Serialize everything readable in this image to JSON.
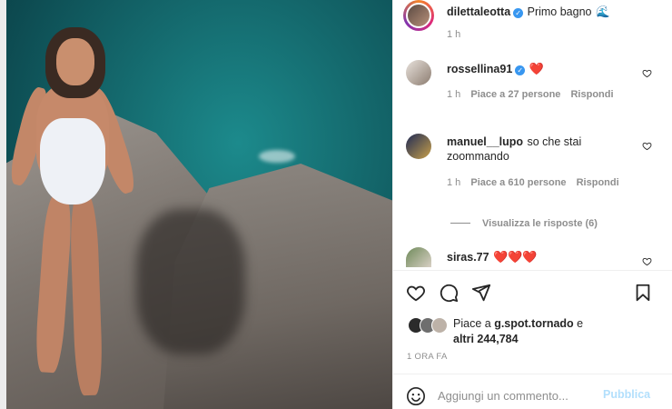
{
  "post": {
    "author": "dilettaleotta",
    "caption": "Primo bagno",
    "caption_emoji": "🌊",
    "time": "1 h"
  },
  "comments": [
    {
      "user": "rossellina91",
      "verified": true,
      "text": "❤️",
      "time": "1 h",
      "likes": "Piace a 27 persone",
      "reply": "Rispondi"
    },
    {
      "user": "manuel__lupo",
      "verified": false,
      "text_line1": "so che stai",
      "text_line2": "zoommando",
      "time": "1 h",
      "likes": "Piace a 610 persone",
      "reply": "Rispondi",
      "view_replies": "Visualizza le risposte (6)"
    },
    {
      "user": "siras.77",
      "verified": false,
      "text": "❤️❤️❤️"
    }
  ],
  "likes": {
    "prefix": "Piace a",
    "user": "g.spot.tornado",
    "suffix": "e",
    "others": "altri 244,784"
  },
  "timestamp": "1 ORA FA",
  "composer": {
    "placeholder": "Aggiungi un commento...",
    "publish_label": "Pubblica"
  },
  "icons": {
    "like": "heart-outline-icon",
    "comment": "comment-bubble-icon",
    "share": "paper-plane-icon",
    "save": "bookmark-icon",
    "emoji": "smiley-icon",
    "verified": "verified-badge-icon"
  },
  "colors": {
    "link_blue": "#3897f0",
    "publish_disabled": "#b2dffc",
    "meta_gray": "#8e8e8e",
    "heart_red": "#ed4956"
  }
}
